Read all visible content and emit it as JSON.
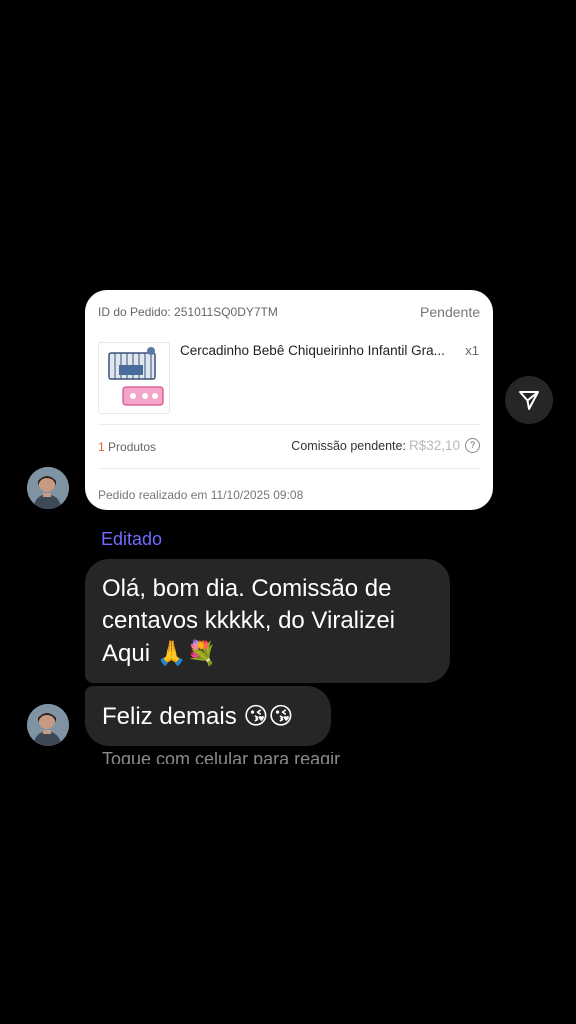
{
  "order_card": {
    "order_id": "ID do Pedido: 251011SQ0DY7TM",
    "status": "Pendente",
    "product_name": "Cercadinho Bebê Chiqueirinho Infantil Gra...",
    "quantity": "x1",
    "products_count": "1",
    "products_label": "Produtos",
    "commission_label": "Comissão pendente:",
    "commission_amount": "R$32,10",
    "placed_at": "Pedido realizado em 11/10/2025 09:08"
  },
  "messages": {
    "edited_label": "Editado",
    "message_1": "Olá, bom dia. Comissão de centavos kkkkk, do Viralizei Aqui",
    "message_1_emojis": "🙏💐",
    "message_2": "Feliz demais",
    "message_2_emojis": "😘😘"
  },
  "footer": {
    "tap_hint": "Toque com celular para reagir"
  },
  "icons": {
    "share": "paper-plane-icon",
    "help": "question-circle-icon"
  },
  "colors": {
    "background": "#000000",
    "bubble": "#262626",
    "edited": "#6f6bff",
    "products_count": "#e0662a"
  }
}
